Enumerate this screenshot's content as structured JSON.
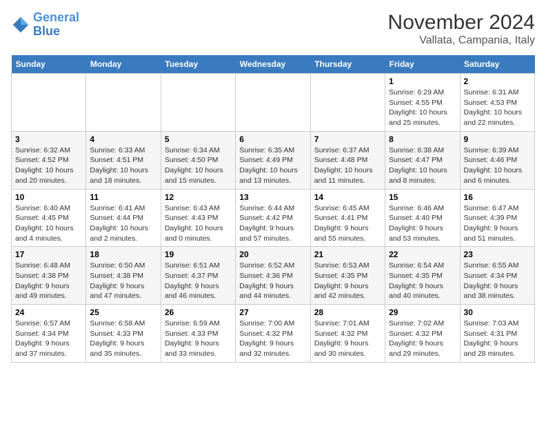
{
  "logo": {
    "line1": "General",
    "line2": "Blue"
  },
  "title": "November 2024",
  "subtitle": "Vallata, Campania, Italy",
  "days_of_week": [
    "Sunday",
    "Monday",
    "Tuesday",
    "Wednesday",
    "Thursday",
    "Friday",
    "Saturday"
  ],
  "weeks": [
    [
      {
        "day": "",
        "info": ""
      },
      {
        "day": "",
        "info": ""
      },
      {
        "day": "",
        "info": ""
      },
      {
        "day": "",
        "info": ""
      },
      {
        "day": "",
        "info": ""
      },
      {
        "day": "1",
        "info": "Sunrise: 6:29 AM\nSunset: 4:55 PM\nDaylight: 10 hours\nand 25 minutes."
      },
      {
        "day": "2",
        "info": "Sunrise: 6:31 AM\nSunset: 4:53 PM\nDaylight: 10 hours\nand 22 minutes."
      }
    ],
    [
      {
        "day": "3",
        "info": "Sunrise: 6:32 AM\nSunset: 4:52 PM\nDaylight: 10 hours\nand 20 minutes."
      },
      {
        "day": "4",
        "info": "Sunrise: 6:33 AM\nSunset: 4:51 PM\nDaylight: 10 hours\nand 18 minutes."
      },
      {
        "day": "5",
        "info": "Sunrise: 6:34 AM\nSunset: 4:50 PM\nDaylight: 10 hours\nand 15 minutes."
      },
      {
        "day": "6",
        "info": "Sunrise: 6:35 AM\nSunset: 4:49 PM\nDaylight: 10 hours\nand 13 minutes."
      },
      {
        "day": "7",
        "info": "Sunrise: 6:37 AM\nSunset: 4:48 PM\nDaylight: 10 hours\nand 11 minutes."
      },
      {
        "day": "8",
        "info": "Sunrise: 6:38 AM\nSunset: 4:47 PM\nDaylight: 10 hours\nand 8 minutes."
      },
      {
        "day": "9",
        "info": "Sunrise: 6:39 AM\nSunset: 4:46 PM\nDaylight: 10 hours\nand 6 minutes."
      }
    ],
    [
      {
        "day": "10",
        "info": "Sunrise: 6:40 AM\nSunset: 4:45 PM\nDaylight: 10 hours\nand 4 minutes."
      },
      {
        "day": "11",
        "info": "Sunrise: 6:41 AM\nSunset: 4:44 PM\nDaylight: 10 hours\nand 2 minutes."
      },
      {
        "day": "12",
        "info": "Sunrise: 6:43 AM\nSunset: 4:43 PM\nDaylight: 10 hours\nand 0 minutes."
      },
      {
        "day": "13",
        "info": "Sunrise: 6:44 AM\nSunset: 4:42 PM\nDaylight: 9 hours\nand 57 minutes."
      },
      {
        "day": "14",
        "info": "Sunrise: 6:45 AM\nSunset: 4:41 PM\nDaylight: 9 hours\nand 55 minutes."
      },
      {
        "day": "15",
        "info": "Sunrise: 6:46 AM\nSunset: 4:40 PM\nDaylight: 9 hours\nand 53 minutes."
      },
      {
        "day": "16",
        "info": "Sunrise: 6:47 AM\nSunset: 4:39 PM\nDaylight: 9 hours\nand 51 minutes."
      }
    ],
    [
      {
        "day": "17",
        "info": "Sunrise: 6:48 AM\nSunset: 4:38 PM\nDaylight: 9 hours\nand 49 minutes."
      },
      {
        "day": "18",
        "info": "Sunrise: 6:50 AM\nSunset: 4:38 PM\nDaylight: 9 hours\nand 47 minutes."
      },
      {
        "day": "19",
        "info": "Sunrise: 6:51 AM\nSunset: 4:37 PM\nDaylight: 9 hours\nand 46 minutes."
      },
      {
        "day": "20",
        "info": "Sunrise: 6:52 AM\nSunset: 4:36 PM\nDaylight: 9 hours\nand 44 minutes."
      },
      {
        "day": "21",
        "info": "Sunrise: 6:53 AM\nSunset: 4:35 PM\nDaylight: 9 hours\nand 42 minutes."
      },
      {
        "day": "22",
        "info": "Sunrise: 6:54 AM\nSunset: 4:35 PM\nDaylight: 9 hours\nand 40 minutes."
      },
      {
        "day": "23",
        "info": "Sunrise: 6:55 AM\nSunset: 4:34 PM\nDaylight: 9 hours\nand 38 minutes."
      }
    ],
    [
      {
        "day": "24",
        "info": "Sunrise: 6:57 AM\nSunset: 4:34 PM\nDaylight: 9 hours\nand 37 minutes."
      },
      {
        "day": "25",
        "info": "Sunrise: 6:58 AM\nSunset: 4:33 PM\nDaylight: 9 hours\nand 35 minutes."
      },
      {
        "day": "26",
        "info": "Sunrise: 6:59 AM\nSunset: 4:33 PM\nDaylight: 9 hours\nand 33 minutes."
      },
      {
        "day": "27",
        "info": "Sunrise: 7:00 AM\nSunset: 4:32 PM\nDaylight: 9 hours\nand 32 minutes."
      },
      {
        "day": "28",
        "info": "Sunrise: 7:01 AM\nSunset: 4:32 PM\nDaylight: 9 hours\nand 30 minutes."
      },
      {
        "day": "29",
        "info": "Sunrise: 7:02 AM\nSunset: 4:32 PM\nDaylight: 9 hours\nand 29 minutes."
      },
      {
        "day": "30",
        "info": "Sunrise: 7:03 AM\nSunset: 4:31 PM\nDaylight: 9 hours\nand 28 minutes."
      }
    ]
  ]
}
